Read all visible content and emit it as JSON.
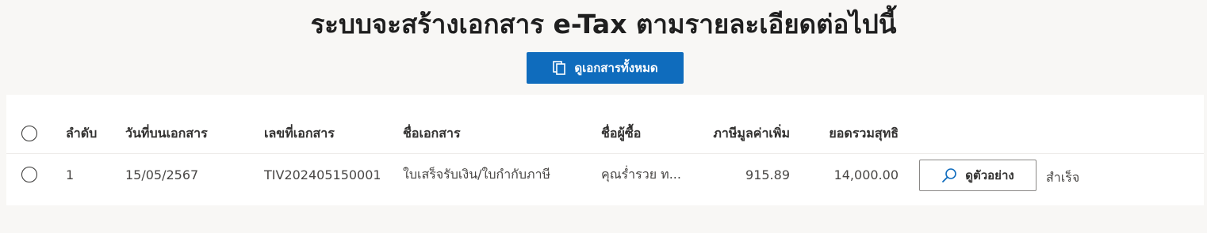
{
  "page": {
    "title": "ระบบจะสร้างเอกสาร e-Tax ตามรายละเอียดต่อไปนี้",
    "view_all_label": "ดูเอกสารทั้งหมด",
    "view_all_icon": "copy-documents-icon",
    "accent_color": "#0f6cbd"
  },
  "table": {
    "columns": {
      "index": "ลำดับ",
      "doc_date": "วันที่บนเอกสาร",
      "doc_number": "เลขที่เอกสาร",
      "doc_name": "ชื่อเอกสาร",
      "buyer": "ชื่อผู้ซื้อ",
      "vat": "ภาษีมูลค่าเพิ่ม",
      "net_total": "ยอดรวมสุทธิ"
    },
    "rows": [
      {
        "index": "1",
        "doc_date": "15/05/2567",
        "doc_number": "TIV202405150001",
        "doc_name": "ใบเสร็จรับเงิน/ใบกำกับภาษี",
        "buyer": "คุณร่ำรวย ท...",
        "vat": "915.89",
        "net_total": "14,000.00",
        "preview_label": "ดูตัวอย่าง",
        "preview_icon": "search-icon",
        "status": "สำเร็จ",
        "status_color": "#107c10"
      }
    ]
  }
}
